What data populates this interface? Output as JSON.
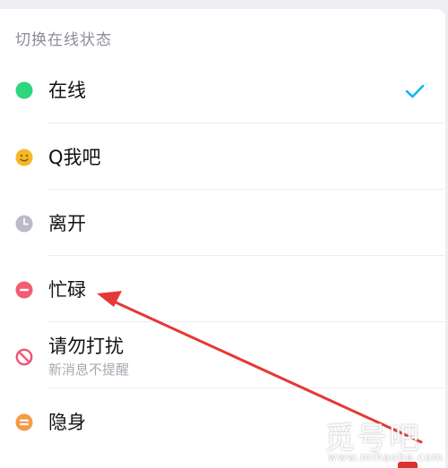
{
  "panel": {
    "title": "切换在线状态"
  },
  "statuses": [
    {
      "label": "在线",
      "icon": "online-dot-icon",
      "color": "#2fd67c",
      "selected": true
    },
    {
      "label": "Q我吧",
      "icon": "smiley-icon",
      "color": "#f5b82a",
      "selected": false
    },
    {
      "label": "离开",
      "icon": "clock-icon",
      "color": "#b9bcc8",
      "selected": false
    },
    {
      "label": "忙碌",
      "icon": "busy-minus-icon",
      "color": "#f35c73",
      "selected": false
    },
    {
      "label": "请勿打扰",
      "sublabel": "新消息不提醒",
      "icon": "no-disturb-icon",
      "color": "#f25273",
      "selected": false
    },
    {
      "label": "隐身",
      "icon": "invisible-equals-icon",
      "color": "#f59b47",
      "selected": false
    }
  ],
  "accent_color": "#12b7f5",
  "annotation_arrow_color": "#e53935",
  "watermark": {
    "text": "觅号吧",
    "url": "www.mihaoba.com"
  }
}
